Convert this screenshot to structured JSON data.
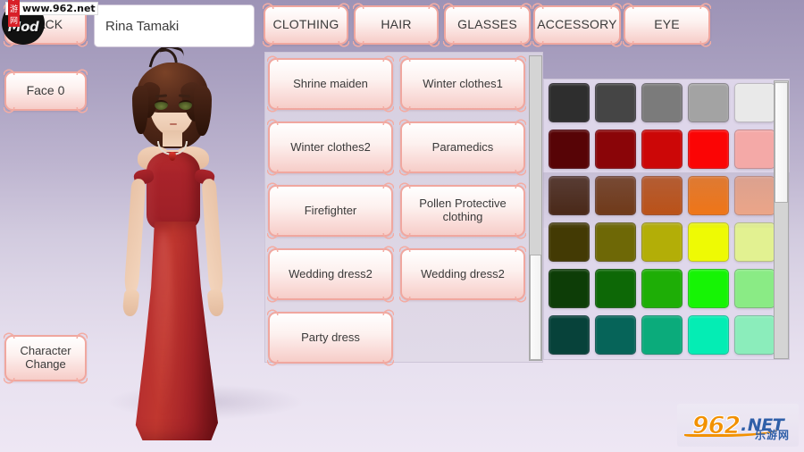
{
  "app": {
    "character_name": "Rina Tamaki",
    "name_placeholder": "Rina Tamaki"
  },
  "left_rail": {
    "back_label": "BACK",
    "face_label": "Face 0",
    "character_change_label": "Character Change"
  },
  "tabs": [
    {
      "id": "clothing",
      "label": "CLOTHING"
    },
    {
      "id": "hair",
      "label": "HAIR"
    },
    {
      "id": "glasses",
      "label": "GLASSES"
    },
    {
      "id": "accessory",
      "label": "ACCESSORY"
    },
    {
      "id": "eye",
      "label": "EYE"
    }
  ],
  "clothing_list": {
    "items": [
      {
        "label": "Shrine maiden"
      },
      {
        "label": "Winter clothes1"
      },
      {
        "label": "Winter clothes2"
      },
      {
        "label": "Paramedics"
      },
      {
        "label": "Firefighter"
      },
      {
        "label": "Pollen Protective clothing"
      },
      {
        "label": "Wedding dress2"
      },
      {
        "label": "Wedding dress2"
      },
      {
        "label": "Party dress"
      }
    ]
  },
  "palette": {
    "columns": 5,
    "swatches": [
      "#2e2e2e",
      "#454545",
      "#7b7b7b",
      "#a3a3a3",
      "#e9e9e9",
      "#570406",
      "#8a0508",
      "#cc0707",
      "#fb0505",
      "#f4a9a7",
      "#401c06",
      "#6b2f07",
      "#bf4a06",
      "#fa7205",
      "#f6a884",
      "#433a04",
      "#6e6806",
      "#b3ae07",
      "#eefa04",
      "#e2f191",
      "#0d3d07",
      "#0d6806",
      "#1eae06",
      "#16f405",
      "#8aeb85",
      "#07423a",
      "#066459",
      "#0bab7b",
      "#04edb4",
      "#8bedbb"
    ]
  },
  "watermark": {
    "badge_text": "Mod",
    "cn_label": "乐游网",
    "url": "www.962.net",
    "logo_number": "962",
    "logo_dot": ".",
    "logo_net": "NET",
    "logo_cn": "乐游网"
  },
  "colors": {
    "button_border": "#f0a79f",
    "panel_bg": "#ded6ea",
    "page_bg": "#e6dcee"
  }
}
